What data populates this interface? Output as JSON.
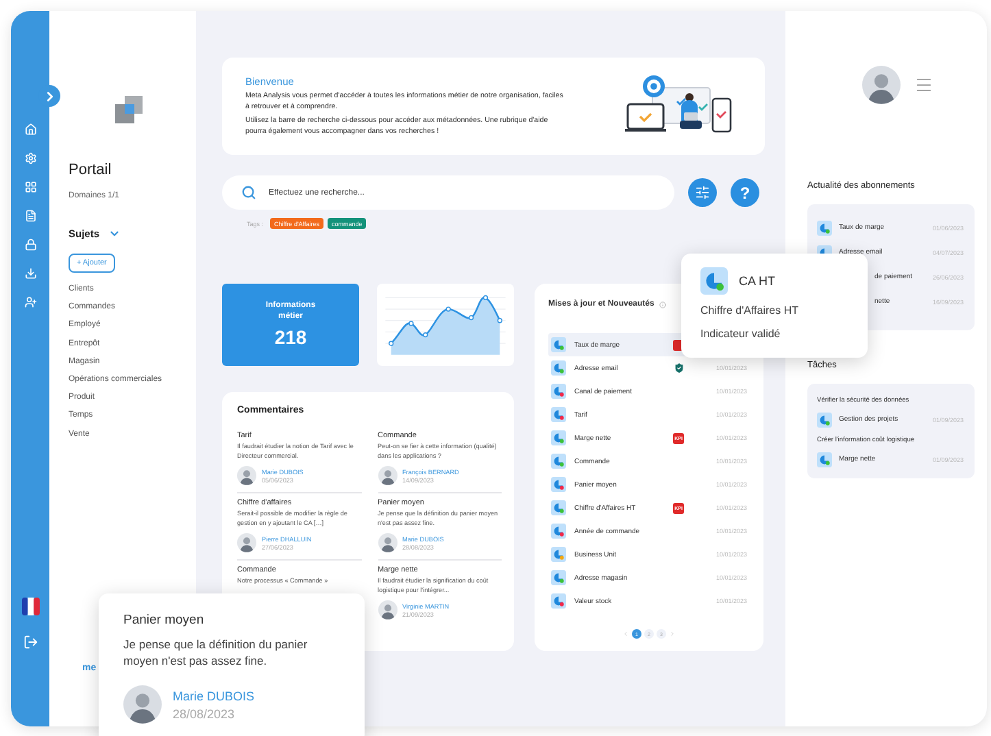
{
  "sidebar": {
    "title": "Portail",
    "domains": "Domaines 1/1",
    "section": {
      "label": "Sujets",
      "expanded": true
    },
    "add_button": "+ Ajouter",
    "items": [
      "Clients",
      "Commandes",
      "Employé",
      "Entrepôt",
      "Magasin",
      "Opérations commerciales",
      "Produit",
      "Temps",
      "Vente"
    ],
    "link": "me"
  },
  "welcome": {
    "title": "Bienvenue",
    "lines": [
      "Meta Analysis vous permet d'accéder à toutes les informations métier de notre organisation, faciles à retrouver et à comprendre.",
      "Utilisez la barre de recherche ci-dessous pour accéder aux métadonnées. Une rubrique d'aide pourra également vous accompagner dans vos recherches !"
    ]
  },
  "search": {
    "placeholder": "Effectuez une recherche...",
    "help_button": "?"
  },
  "tags": {
    "label": "Tags :",
    "items": [
      {
        "label": "Chiffre d'Affaires",
        "color": "#f26a1b"
      },
      {
        "label": "commande",
        "color": "#13927a"
      }
    ]
  },
  "stat": {
    "label": "Informations métier",
    "value": "218"
  },
  "comments": {
    "title": "Commentaires",
    "items": [
      {
        "title": "Tarif",
        "text": "Il faudrait étudier la notion de Tarif avec le Directeur commercial.",
        "author": "Marie DUBOIS",
        "date": "05/06/2023"
      },
      {
        "title": "Commande",
        "text": "Peut-on se fier à cette information (qualité) dans les applications ?",
        "author": "François BERNARD",
        "date": "14/09/2023"
      },
      {
        "title": "Chiffre d'affaires",
        "text": "Serait-il possible de modifier la règle de gestion en y ajoutant le CA […]",
        "author": "Pierre DHALLUIN",
        "date": "27/06/2023"
      },
      {
        "title": "Panier moyen",
        "text": "Je pense que la définition du panier moyen n'est pas assez fine.",
        "author": "Marie DUBOIS",
        "date": "28/08/2023"
      },
      {
        "title": "Commande",
        "text": "Notre processus « Commande »"
      },
      {
        "title": "Marge nette",
        "text": "Il faudrait étudier la signification du coût logistique pour l'intégrer...",
        "author": "Virginie MARTIN",
        "date": "21/09/2023"
      }
    ]
  },
  "updates": {
    "title": "Mises à jour et Nouveautés",
    "items": [
      {
        "label": "Taux de marge",
        "color": "#3cc13b",
        "selected": true,
        "badge": {
          "kind": "kpi"
        }
      },
      {
        "label": "Adresse email",
        "color": "#3cc13b",
        "selected": false,
        "badge": {
          "kind": "validated"
        },
        "date": "10/01/2023"
      },
      {
        "label": "Canal de paiement",
        "color": "#f0284a",
        "selected": false,
        "date": "10/01/2023"
      },
      {
        "label": "Tarif",
        "color": "#f0284a",
        "selected": false,
        "date": "10/01/2023"
      },
      {
        "label": "Marge nette",
        "color": "#3cc13b",
        "selected": false,
        "badge": {
          "kind": "kpi",
          "label": "KPI"
        },
        "date": "10/01/2023"
      },
      {
        "label": "Commande",
        "color": "#3cc13b",
        "selected": false,
        "date": "10/01/2023"
      },
      {
        "label": "Panier moyen",
        "color": "#f0284a",
        "selected": false,
        "date": "10/01/2023"
      },
      {
        "label": "Chiffre d'Affaires HT",
        "color": "#3cc13b",
        "selected": false,
        "badge": {
          "kind": "kpi",
          "label": "KPI"
        },
        "date": "10/01/2023"
      },
      {
        "label": "Année de commande",
        "color": "#f0284a",
        "selected": false,
        "date": "10/01/2023"
      },
      {
        "label": "Business Unit",
        "color": "#f3a712",
        "selected": false,
        "date": "10/01/2023"
      },
      {
        "label": "Adresse magasin",
        "color": "#3cc13b",
        "selected": false,
        "date": "10/01/2023"
      },
      {
        "label": "Valeur stock",
        "color": "#f0284a",
        "selected": false,
        "date": "10/01/2023"
      }
    ],
    "pages": [
      {
        "label": "1",
        "selected": true
      },
      {
        "label": "2",
        "selected": false
      },
      {
        "label": "3",
        "selected": false
      }
    ]
  },
  "subscriptions": {
    "title": "Actualité des abonnements",
    "items": [
      {
        "kind": "full",
        "label": "Taux de marge",
        "date": "01/06/2023",
        "color": "#3cc13b"
      },
      {
        "kind": "icon",
        "label": "Adresse email",
        "date": "04/07/2023"
      },
      {
        "kind": "cut",
        "label": "de paiement",
        "date": "26/06/2023"
      },
      {
        "kind": "cut",
        "label": "nette",
        "date": "16/09/2023"
      }
    ]
  },
  "tasks": {
    "title": "Tâches",
    "items": [
      {
        "title": "Vérifier la sécurité des données",
        "label": "Gestion des projets",
        "date": "01/09/2023",
        "color": "#3cc13b"
      },
      {
        "title": "Créer l'information coût logistique",
        "label": "Marge nette",
        "date": "01/09/2023",
        "color": "#3cc13b"
      }
    ]
  },
  "indicator_popup": {
    "title": "CA HT",
    "color": "#3cc13b",
    "lines": [
      "Chiffre d'Affaires HT",
      "Indicateur validé"
    ]
  },
  "comment_popup": {
    "title": "Panier moyen",
    "text": "Je pense que la définition du panier moyen n'est pas assez fine.",
    "author": "Marie DUBOIS",
    "date": "28/08/2023"
  }
}
